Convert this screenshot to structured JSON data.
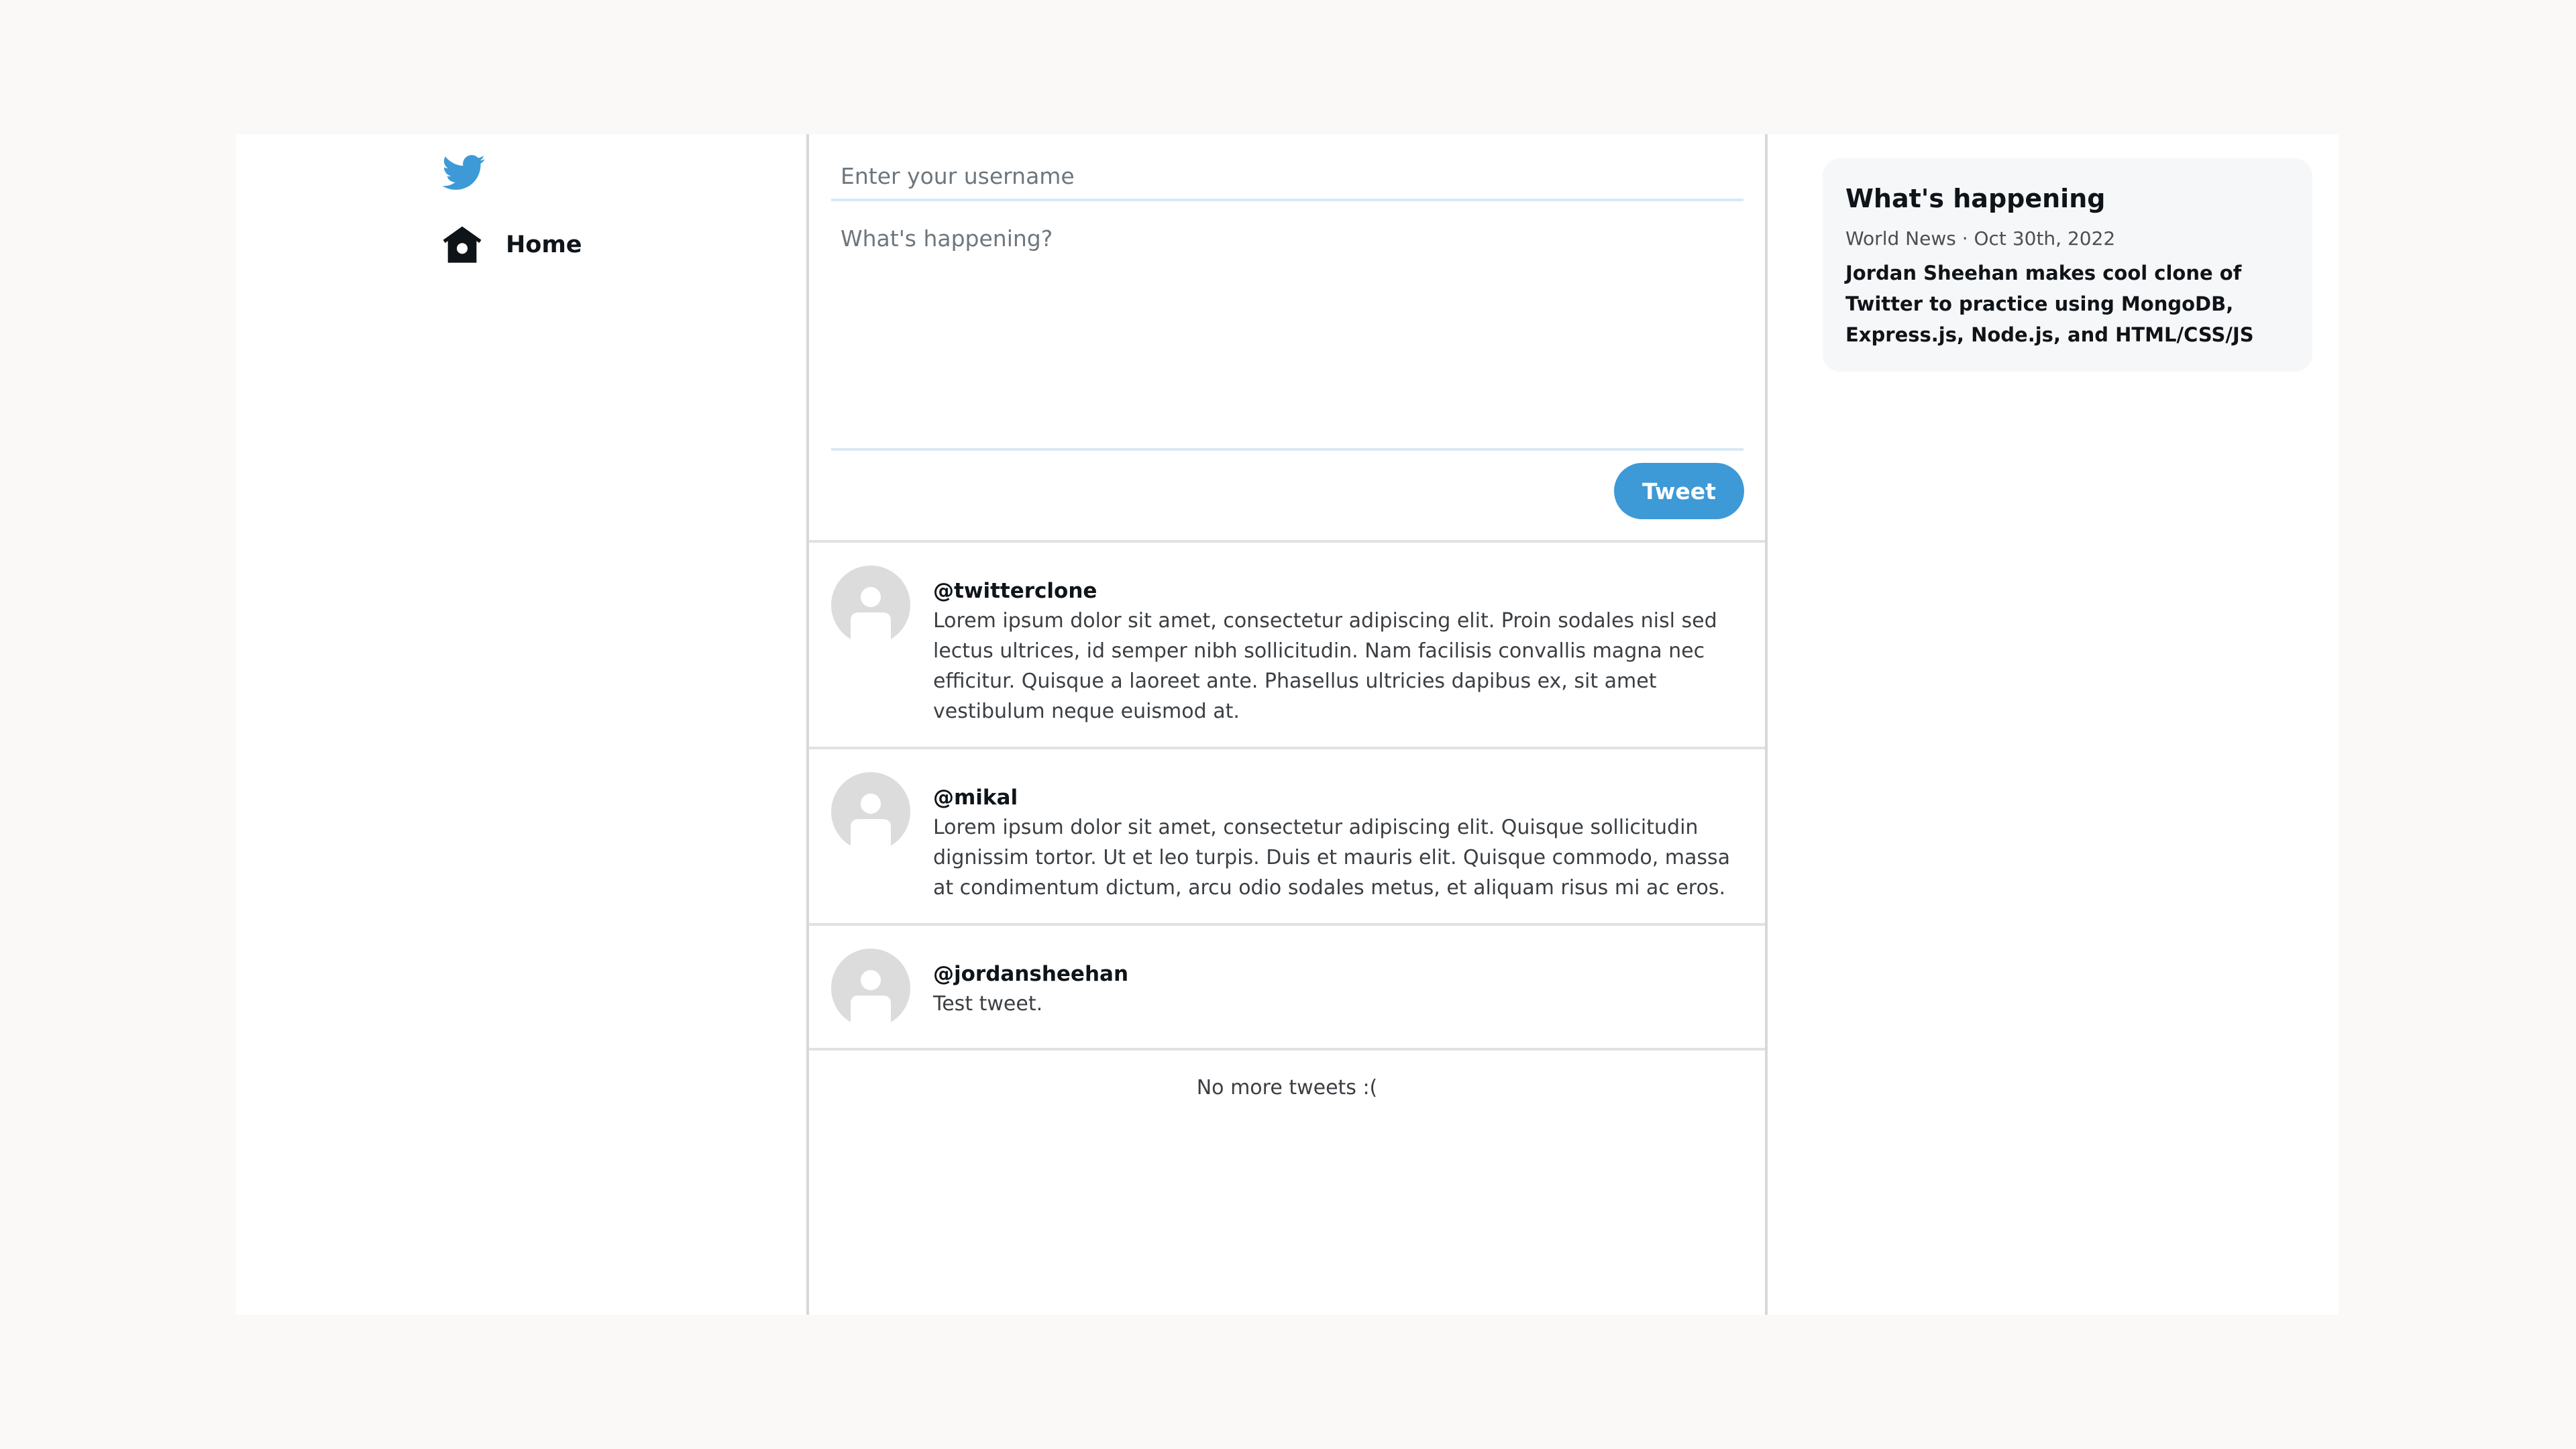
{
  "nav": {
    "logo_icon": "twitter-bird-icon",
    "home_icon": "home-icon",
    "home_label": "Home",
    "brand_color": "#3d9ad7"
  },
  "composer": {
    "username_placeholder": "Enter your username",
    "username_value": "",
    "tweet_placeholder": "What's happening?",
    "tweet_value": "",
    "submit_label": "Tweet"
  },
  "feed": {
    "tweets": [
      {
        "username": "@twitterclone",
        "text": "Lorem ipsum dolor sit amet, consectetur adipiscing elit. Proin sodales nisl sed lectus ultrices, id semper nibh sollicitudin. Nam facilisis convallis magna nec efficitur. Quisque a laoreet ante. Phasellus ultricies dapibus ex, sit amet vestibulum neque euismod at."
      },
      {
        "username": "@mikal",
        "text": "Lorem ipsum dolor sit amet, consectetur adipiscing elit. Quisque sollicitudin dignissim tortor. Ut et leo turpis. Duis et mauris elit. Quisque commodo, massa at condimentum dictum, arcu odio sodales metus, et aliquam risus mi ac eros."
      },
      {
        "username": "@jordansheehan",
        "text": "Test tweet."
      }
    ],
    "end_message": "No more tweets :("
  },
  "sidebar": {
    "title": "What's happening",
    "meta": "World News · Oct 30th, 2022",
    "headline": "Jordan Sheehan makes cool clone of Twitter to practice using MongoDB, Express.js, Node.js, and HTML/CSS/JS"
  }
}
